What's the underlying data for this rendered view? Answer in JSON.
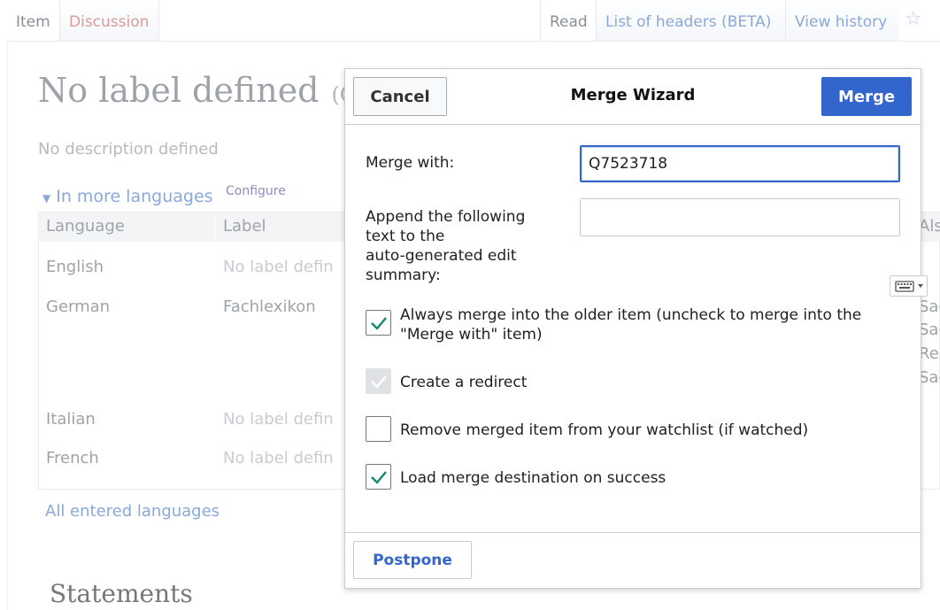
{
  "tabs": {
    "item": "Item",
    "discussion": "Discussion",
    "read": "Read",
    "list_of_headers": "List of headers (BETA)",
    "view_history": "View history"
  },
  "page": {
    "title": "No label defined",
    "qid_fragment": "(Q",
    "description": "No description defined",
    "more_languages": "In more languages",
    "configure": "Configure",
    "all_entered_languages": "All entered languages",
    "statements": "Statements"
  },
  "lang_table": {
    "headers": [
      "Language",
      "Label"
    ],
    "right_header_peek": "Als",
    "rows": [
      {
        "language": "English",
        "label": "No label defin",
        "label_missing": true
      },
      {
        "language": "German",
        "label": "Fachlexikon",
        "label_missing": false
      },
      {
        "language": "Italian",
        "label": "No label defin",
        "label_missing": true
      },
      {
        "language": "French",
        "label": "No label defin",
        "label_missing": true
      }
    ],
    "right_peek_rows": [
      "Sac",
      "Sac",
      "Rea",
      "Sac"
    ]
  },
  "dialog": {
    "title": "Merge Wizard",
    "cancel_label": "Cancel",
    "merge_label": "Merge",
    "postpone_label": "Postpone",
    "merge_with_label": "Merge with:",
    "merge_with_value": "Q7523718",
    "summary_label_lines": [
      "Append the following",
      "text to the",
      "auto-generated edit",
      "summary:"
    ],
    "summary_value": "",
    "options": [
      {
        "label_lines": [
          "Always merge into the older item (uncheck to merge into the",
          "\"Merge with\" item)"
        ],
        "checked": true,
        "disabled": false
      },
      {
        "label_lines": [
          "Create a redirect"
        ],
        "checked": true,
        "disabled": true
      },
      {
        "label_lines": [
          "Remove merged item from your watchlist (if watched)"
        ],
        "checked": false,
        "disabled": false
      },
      {
        "label_lines": [
          "Load merge destination on success"
        ],
        "checked": true,
        "disabled": false
      }
    ]
  },
  "icons": {
    "star": "star-icon",
    "keyboard": "keyboard-icon",
    "checkmark": "checkmark-icon"
  },
  "colors": {
    "accent": "#3366cc",
    "check": "#14866d",
    "link": "#8aa8d8"
  }
}
